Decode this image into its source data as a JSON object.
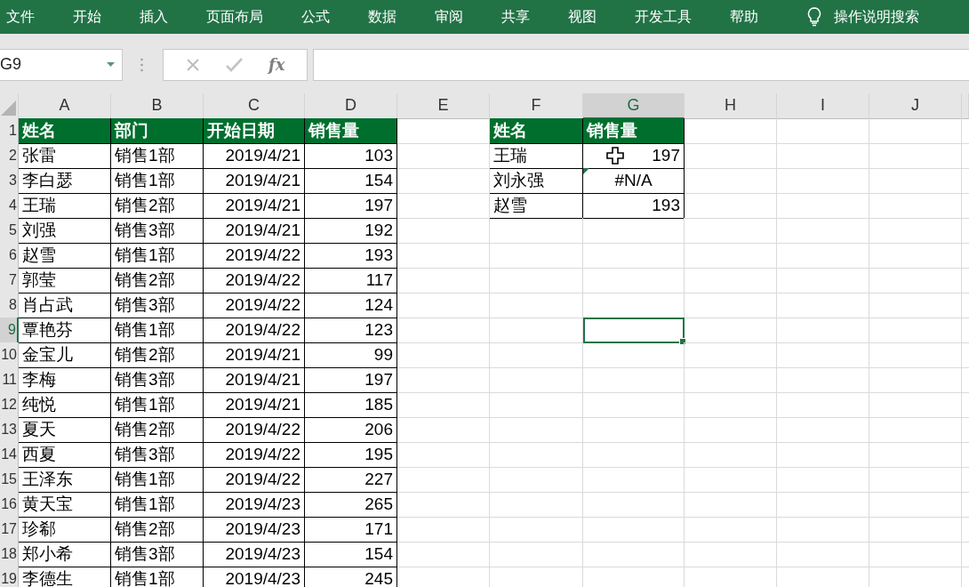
{
  "ribbon": {
    "tabs": [
      "文件",
      "开始",
      "插入",
      "页面布局",
      "公式",
      "数据",
      "审阅",
      "共享",
      "视图",
      "开发工具",
      "帮助"
    ],
    "search_label": "操作说明搜索"
  },
  "formula_bar": {
    "name_box": "G9",
    "function_label": "fx"
  },
  "sheet": {
    "columns": [
      {
        "label": "A",
        "selected": false
      },
      {
        "label": "B",
        "selected": false
      },
      {
        "label": "C",
        "selected": false
      },
      {
        "label": "D",
        "selected": false
      },
      {
        "label": "E",
        "selected": false
      },
      {
        "label": "F",
        "selected": false
      },
      {
        "label": "G",
        "selected": true
      },
      {
        "label": "H",
        "selected": false
      },
      {
        "label": "I",
        "selected": false
      },
      {
        "label": "J",
        "selected": false
      }
    ],
    "row_numbers": [
      {
        "label": "1",
        "selected": false
      },
      {
        "label": "2",
        "selected": false
      },
      {
        "label": "3",
        "selected": false
      },
      {
        "label": "4",
        "selected": false
      },
      {
        "label": "5",
        "selected": false
      },
      {
        "label": "6",
        "selected": false
      },
      {
        "label": "7",
        "selected": false
      },
      {
        "label": "8",
        "selected": false
      },
      {
        "label": "9",
        "selected": true
      },
      {
        "label": "10",
        "selected": false
      },
      {
        "label": "11",
        "selected": false
      },
      {
        "label": "12",
        "selected": false
      },
      {
        "label": "13",
        "selected": false
      },
      {
        "label": "14",
        "selected": false
      },
      {
        "label": "15",
        "selected": false
      },
      {
        "label": "16",
        "selected": false
      },
      {
        "label": "17",
        "selected": false
      },
      {
        "label": "18",
        "selected": false
      },
      {
        "label": "19",
        "selected": false
      }
    ],
    "sales_table": {
      "header": [
        "姓名",
        "部门",
        "开始日期",
        "销售量"
      ],
      "rows": [
        [
          "张雷",
          "销售1部",
          "2019/4/21",
          "103"
        ],
        [
          "李白瑟",
          "销售1部",
          "2019/4/21",
          "154"
        ],
        [
          "王瑞",
          "销售2部",
          "2019/4/21",
          "197"
        ],
        [
          "刘强",
          "销售3部",
          "2019/4/21",
          "192"
        ],
        [
          "赵雪",
          "销售1部",
          "2019/4/22",
          "193"
        ],
        [
          "郭莹",
          "销售2部",
          "2019/4/22",
          "117"
        ],
        [
          "肖占武",
          "销售3部",
          "2019/4/22",
          "124"
        ],
        [
          "覃艳芬",
          "销售1部",
          "2019/4/22",
          "123"
        ],
        [
          "金宝儿",
          "销售2部",
          "2019/4/21",
          "99"
        ],
        [
          "李梅",
          "销售3部",
          "2019/4/21",
          "197"
        ],
        [
          "纯悦",
          "销售1部",
          "2019/4/21",
          "185"
        ],
        [
          "夏天",
          "销售2部",
          "2019/4/22",
          "206"
        ],
        [
          "西夏",
          "销售3部",
          "2019/4/22",
          "195"
        ],
        [
          "王泽东",
          "销售1部",
          "2019/4/22",
          "227"
        ],
        [
          "黄天宝",
          "销售1部",
          "2019/4/23",
          "265"
        ],
        [
          "珍郗",
          "销售2部",
          "2019/4/23",
          "171"
        ],
        [
          "郑小希",
          "销售3部",
          "2019/4/23",
          "154"
        ],
        [
          "李德生",
          "销售1部",
          "2019/4/23",
          "245"
        ]
      ]
    },
    "lookup_table": {
      "header": [
        "姓名",
        "销售量"
      ],
      "rows": [
        {
          "name": "王瑞",
          "sales": "197",
          "kind": "number",
          "error_flag": false,
          "cursor": true
        },
        {
          "name": "刘永强",
          "sales": "#N/A",
          "kind": "error",
          "error_flag": true,
          "cursor": false
        },
        {
          "name": "赵雪",
          "sales": "193",
          "kind": "number",
          "error_flag": false,
          "cursor": false
        }
      ]
    }
  }
}
